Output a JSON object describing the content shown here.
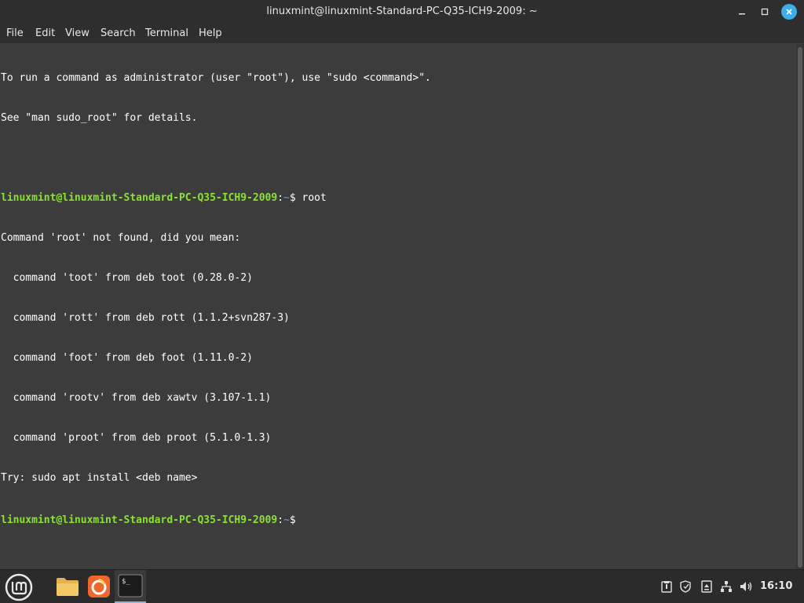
{
  "window": {
    "title": "linuxmint@linuxmint-Standard-PC-Q35-ICH9-2009: ~",
    "controls": {
      "minimize": "minimize-icon",
      "maximize": "maximize-icon",
      "close": "close-icon"
    }
  },
  "menubar": {
    "items": [
      {
        "label": "File"
      },
      {
        "label": "Edit"
      },
      {
        "label": "View"
      },
      {
        "label": "Search"
      },
      {
        "label": "Terminal"
      },
      {
        "label": "Help"
      }
    ]
  },
  "terminal": {
    "line0": "To run a command as administrator (user \"root\"), use \"sudo <command>\".",
    "line1": "See \"man sudo_root\" for details.",
    "line2": "",
    "prompt_user": "linuxmint@linuxmint-Standard-PC-Q35-ICH9-2009",
    "prompt_sep": ":",
    "prompt_path": "~",
    "prompt_sign": "$ ",
    "command": "root",
    "out0": "Command 'root' not found, did you mean:",
    "out1": "  command 'toot' from deb toot (0.28.0-2)",
    "out2": "  command 'rott' from deb rott (1.1.2+svn287-3)",
    "out3": "  command 'foot' from deb foot (1.11.0-2)",
    "out4": "  command 'rootv' from deb xawtv (3.107-1.1)",
    "out5": "  command 'proot' from deb proot (5.1.0-1.3)",
    "out6": "Try: sudo apt install <deb name>"
  },
  "taskbar": {
    "menu_icon": "mint-logo-icon",
    "apps": [
      "folder-icon",
      "firefox-icon",
      "terminal-icon"
    ],
    "tray": [
      "clipboard-icon",
      "shield-icon",
      "update-icon",
      "network-icon",
      "volume-icon"
    ],
    "clock": "16:10"
  },
  "colors": {
    "prompt_user": "#8ae234",
    "prompt_path": "#729fcf",
    "close_button": "#3daee9",
    "terminal_bg": "#3c3c3c"
  }
}
